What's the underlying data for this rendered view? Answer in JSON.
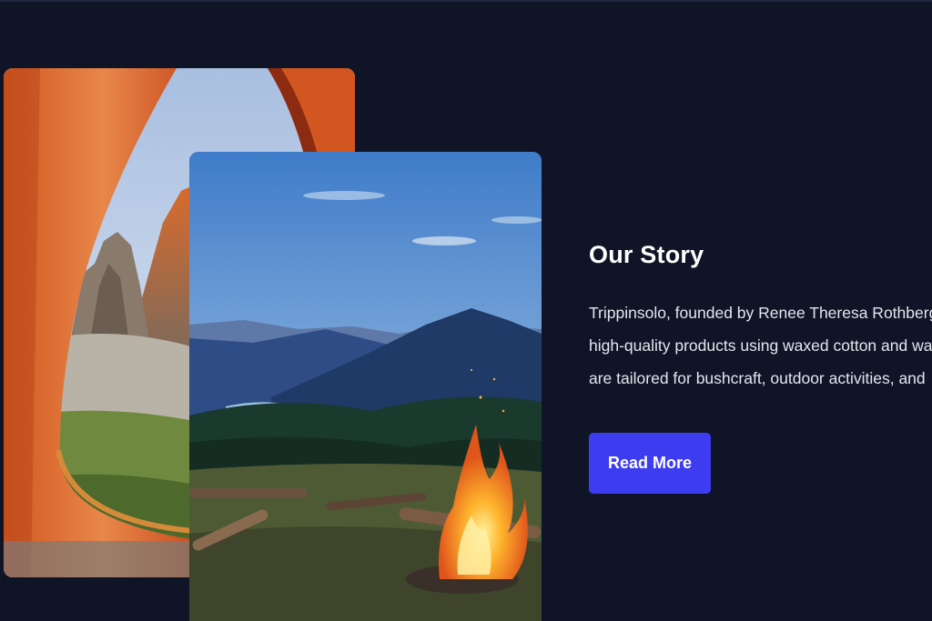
{
  "story": {
    "title": "Our Story",
    "body_lines": [
      "Trippinsolo, founded by Renee Theresa Rothberg",
      "high-quality products using waxed cotton and wa",
      "are tailored for bushcraft, outdoor activities, and"
    ]
  },
  "cta": {
    "label": "Read More"
  },
  "colors": {
    "background": "#0f1526",
    "button": "#3d3cf0",
    "title_text": "#ffffff",
    "body_text": "#e3e6ee"
  }
}
